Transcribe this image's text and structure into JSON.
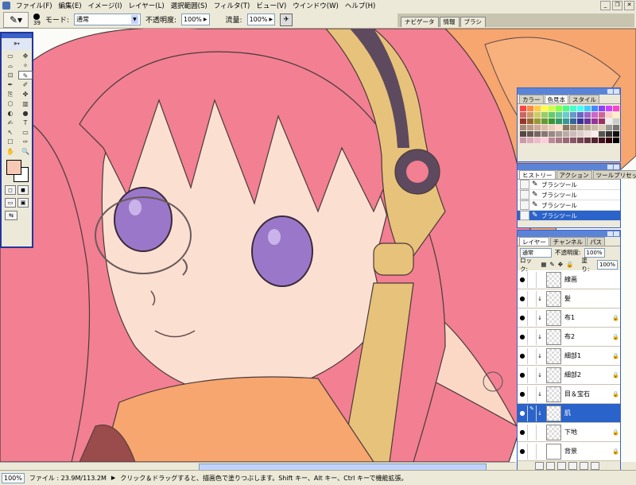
{
  "menubar": {
    "items": [
      "ファイル(F)",
      "編集(E)",
      "イメージ(I)",
      "レイヤー(L)",
      "選択範囲(S)",
      "フィルタ(T)",
      "ビュー(V)",
      "ウインドウ(W)",
      "ヘルプ(H)"
    ]
  },
  "options": {
    "brush_size": "39",
    "mode_label": "モード:",
    "mode_value": "通常",
    "opacity_label": "不透明度:",
    "opacity_value": "100%",
    "flow_label": "流量:",
    "flow_value": "100%"
  },
  "palette_well": {
    "tabs": [
      "ナビゲータ",
      "情報",
      "ブラシ"
    ]
  },
  "toolbox": {
    "tools": [
      "▭",
      "✥",
      "⌓",
      "✧",
      "⊡",
      "✎",
      "✒",
      "✐",
      "⎘",
      "✤",
      "⬡",
      "▥",
      "◐",
      "●",
      "✍",
      "T",
      "↖",
      "▭",
      "☐",
      "✑",
      "✋",
      "🔍"
    ]
  },
  "swatches_panel": {
    "tabs": [
      "カラー",
      "色見本",
      "スタイル"
    ],
    "colors": [
      "#f44",
      "#f84",
      "#fc4",
      "#ff4",
      "#cf4",
      "#8f4",
      "#4f8",
      "#4fc",
      "#4ff",
      "#4cf",
      "#48f",
      "#84f",
      "#c4f",
      "#f4c",
      "#c66",
      "#c96",
      "#cc6",
      "#9c6",
      "#6c6",
      "#6c9",
      "#6cc",
      "#69c",
      "#66c",
      "#96c",
      "#c6c",
      "#c69",
      "#fcc",
      "#fec",
      "#933",
      "#963",
      "#993",
      "#693",
      "#393",
      "#396",
      "#399",
      "#369",
      "#339",
      "#639",
      "#939",
      "#936",
      "#eee",
      "#ccc",
      "#a87",
      "#b98",
      "#ca9",
      "#dba",
      "#ecb",
      "#fdc",
      "#876",
      "#987",
      "#a98",
      "#ba9",
      "#cba",
      "#dcb",
      "#999",
      "#777",
      "#544",
      "#655",
      "#766",
      "#877",
      "#988",
      "#a99",
      "#baa",
      "#cbb",
      "#dcc",
      "#edd",
      "#fee",
      "#555",
      "#333",
      "#111",
      "#c9a",
      "#dab",
      "#ebc",
      "#fcd",
      "#b89",
      "#a78",
      "#967",
      "#856",
      "#745",
      "#634",
      "#523",
      "#412",
      "#301",
      "#000"
    ]
  },
  "history_panel": {
    "tabs": [
      "ヒストリー",
      "アクション",
      "ツールプリセット"
    ],
    "items": [
      "ブラシツール",
      "ブラシツール",
      "ブラシツール",
      "ブラシツール"
    ]
  },
  "layers_panel": {
    "tabs": [
      "レイヤー",
      "チャンネル",
      "パス"
    ],
    "blend_mode": "通常",
    "opacity_label": "不透明度:",
    "opacity_value": "100%",
    "lock_label": "ロック:",
    "fill_label": "塗り:",
    "fill_value": "100%",
    "layers": [
      {
        "name": "線画"
      },
      {
        "name": "髪"
      },
      {
        "name": "布1"
      },
      {
        "name": "布2"
      },
      {
        "name": "細部1"
      },
      {
        "name": "細部2"
      },
      {
        "name": "目＆宝石"
      },
      {
        "name": "肌"
      },
      {
        "name": "下地"
      },
      {
        "name": "背景"
      }
    ]
  },
  "status": {
    "zoom": "100%",
    "file_info": "ファイル : 23.9M/113.2M",
    "hint": "クリック＆ドラッグすると、描画色で塗りつぶします。Shift キー、Alt キー、Ctrl キーで機能拡張。"
  },
  "colors": {
    "foreground": "#f7c9b4",
    "background": "#ffffff",
    "hair": "#f27f92",
    "skin": "#fbe0d2",
    "eye": "#9b77c9",
    "gold": "#e7c27a",
    "orange": "#f6a66e",
    "selection": "#2a63c9"
  }
}
